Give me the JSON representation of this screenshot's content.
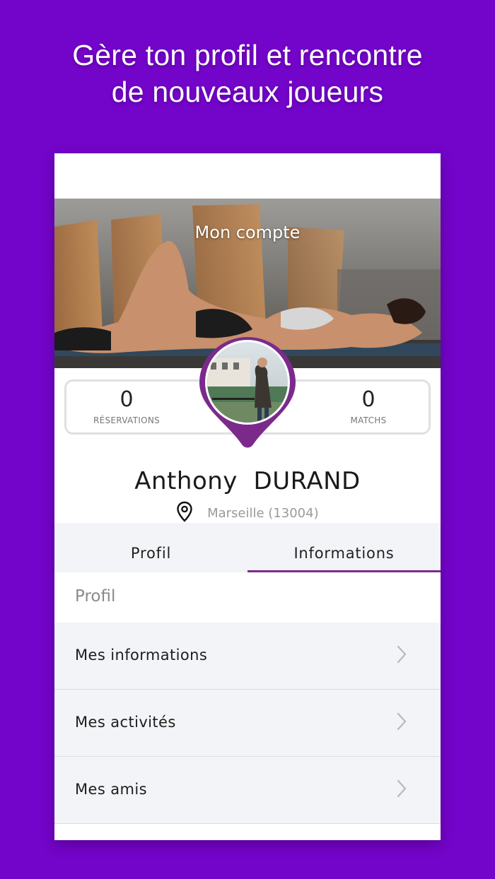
{
  "headline": {
    "line1": "Gère ton profil et rencontre",
    "line2": "de nouveaux joueurs"
  },
  "screen": {
    "hero_title": "Mon compte",
    "stats": {
      "reservations_count": "0",
      "reservations_label": "RÉSERVATIONS",
      "matchs_count": "0",
      "matchs_label": "MATCHS"
    },
    "user": {
      "first_name": "Anthony",
      "last_name": "DURAND",
      "location": "Marseille (13004)"
    },
    "tabs": [
      {
        "label": "Profil",
        "active": false
      },
      {
        "label": "Informations",
        "active": true
      }
    ],
    "section_title": "Profil",
    "menu": [
      {
        "label": "Mes informations"
      },
      {
        "label": "Mes activités"
      },
      {
        "label": "Mes amis"
      }
    ]
  },
  "colors": {
    "background": "#7304c9",
    "accent": "#7b2a8c"
  },
  "icons": [
    "location-pin-icon",
    "chevron-right-icon"
  ]
}
